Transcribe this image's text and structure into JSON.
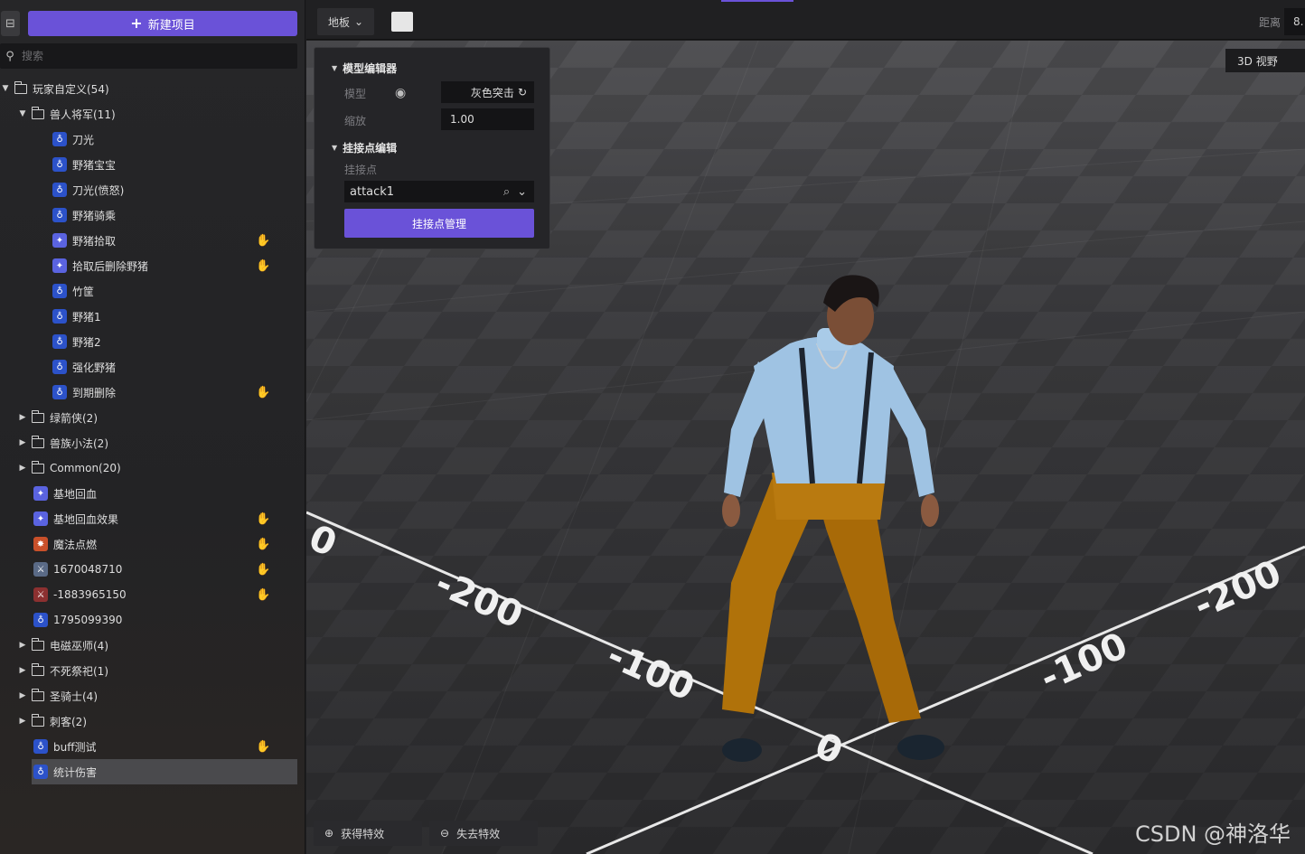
{
  "sidebar": {
    "new_project_label": "新建项目",
    "search_placeholder": "搜索",
    "tree": [
      {
        "label": "玩家自定义(54)",
        "type": "folder",
        "expanded": true
      },
      {
        "label": "兽人将军(11)",
        "type": "folder",
        "expanded": true
      },
      {
        "label": "刀光",
        "icon": "blue-helmet-icon"
      },
      {
        "label": "野猪宝宝",
        "icon": "blue-helmet-icon"
      },
      {
        "label": "刀光(愤怒)",
        "icon": "blue-helmet-icon"
      },
      {
        "label": "野猪骑乘",
        "icon": "blue-helmet-icon"
      },
      {
        "label": "野猪拾取",
        "icon": "blue-creature-icon",
        "hand": true
      },
      {
        "label": "拾取后删除野猪",
        "icon": "blue-creature-icon",
        "hand": true
      },
      {
        "label": "竹筐",
        "icon": "blue-helmet-icon"
      },
      {
        "label": "野猪1",
        "icon": "blue-helmet-icon"
      },
      {
        "label": "野猪2",
        "icon": "blue-helmet-icon"
      },
      {
        "label": "强化野猪",
        "icon": "blue-helmet-icon"
      },
      {
        "label": "到期删除",
        "icon": "blue-helmet-icon",
        "hand": true
      },
      {
        "label": "绿箭侠(2)",
        "type": "folder"
      },
      {
        "label": "兽族小法(2)",
        "type": "folder"
      },
      {
        "label": "Common(20)",
        "type": "folder"
      },
      {
        "label": "基地回血",
        "icon": "blue-creature-icon"
      },
      {
        "label": "基地回血效果",
        "icon": "blue-creature-icon",
        "hand": true
      },
      {
        "label": "魔法点燃",
        "icon": "fire-icon",
        "hand": true
      },
      {
        "label": "1670048710",
        "icon": "warrior-icon",
        "hand": true
      },
      {
        "label": "-1883965150",
        "icon": "warrior-red-icon",
        "hand": true
      },
      {
        "label": "1795099390",
        "icon": "blue-helmet-icon"
      },
      {
        "label": "电磁巫师(4)",
        "type": "folder"
      },
      {
        "label": "不死祭祀(1)",
        "type": "folder"
      },
      {
        "label": "圣骑士(4)",
        "type": "folder"
      },
      {
        "label": "刺客(2)",
        "type": "folder"
      },
      {
        "label": "buff测试",
        "icon": "blue-helmet-icon",
        "hand": true
      },
      {
        "label": "统计伤害",
        "icon": "blue-helmet-icon",
        "selected": true
      }
    ]
  },
  "topbar": {
    "floor_label": "地板",
    "distance_label": "距离",
    "distance_value": "8.",
    "floor_color": "#e6e6e6"
  },
  "viewport": {
    "view_label": "3D 视野",
    "axis_labels": [
      "-200",
      "-100",
      "0",
      "-100",
      "-200",
      "0"
    ]
  },
  "panel": {
    "model_editor_title": "模型编辑器",
    "model_label": "模型",
    "model_value": "灰色突击",
    "scale_label": "缩放",
    "scale_value": "1.00",
    "attach_editor_title": "挂接点编辑",
    "attach_label": "挂接点",
    "attach_value": "attack1",
    "manage_button": "挂接点管理"
  },
  "bottom": {
    "gain_effect": "获得特效",
    "lose_effect": "失去特效"
  },
  "watermark": "CSDN @神洛华",
  "colors": {
    "accent": "#6a52d8",
    "background": "#202022"
  }
}
